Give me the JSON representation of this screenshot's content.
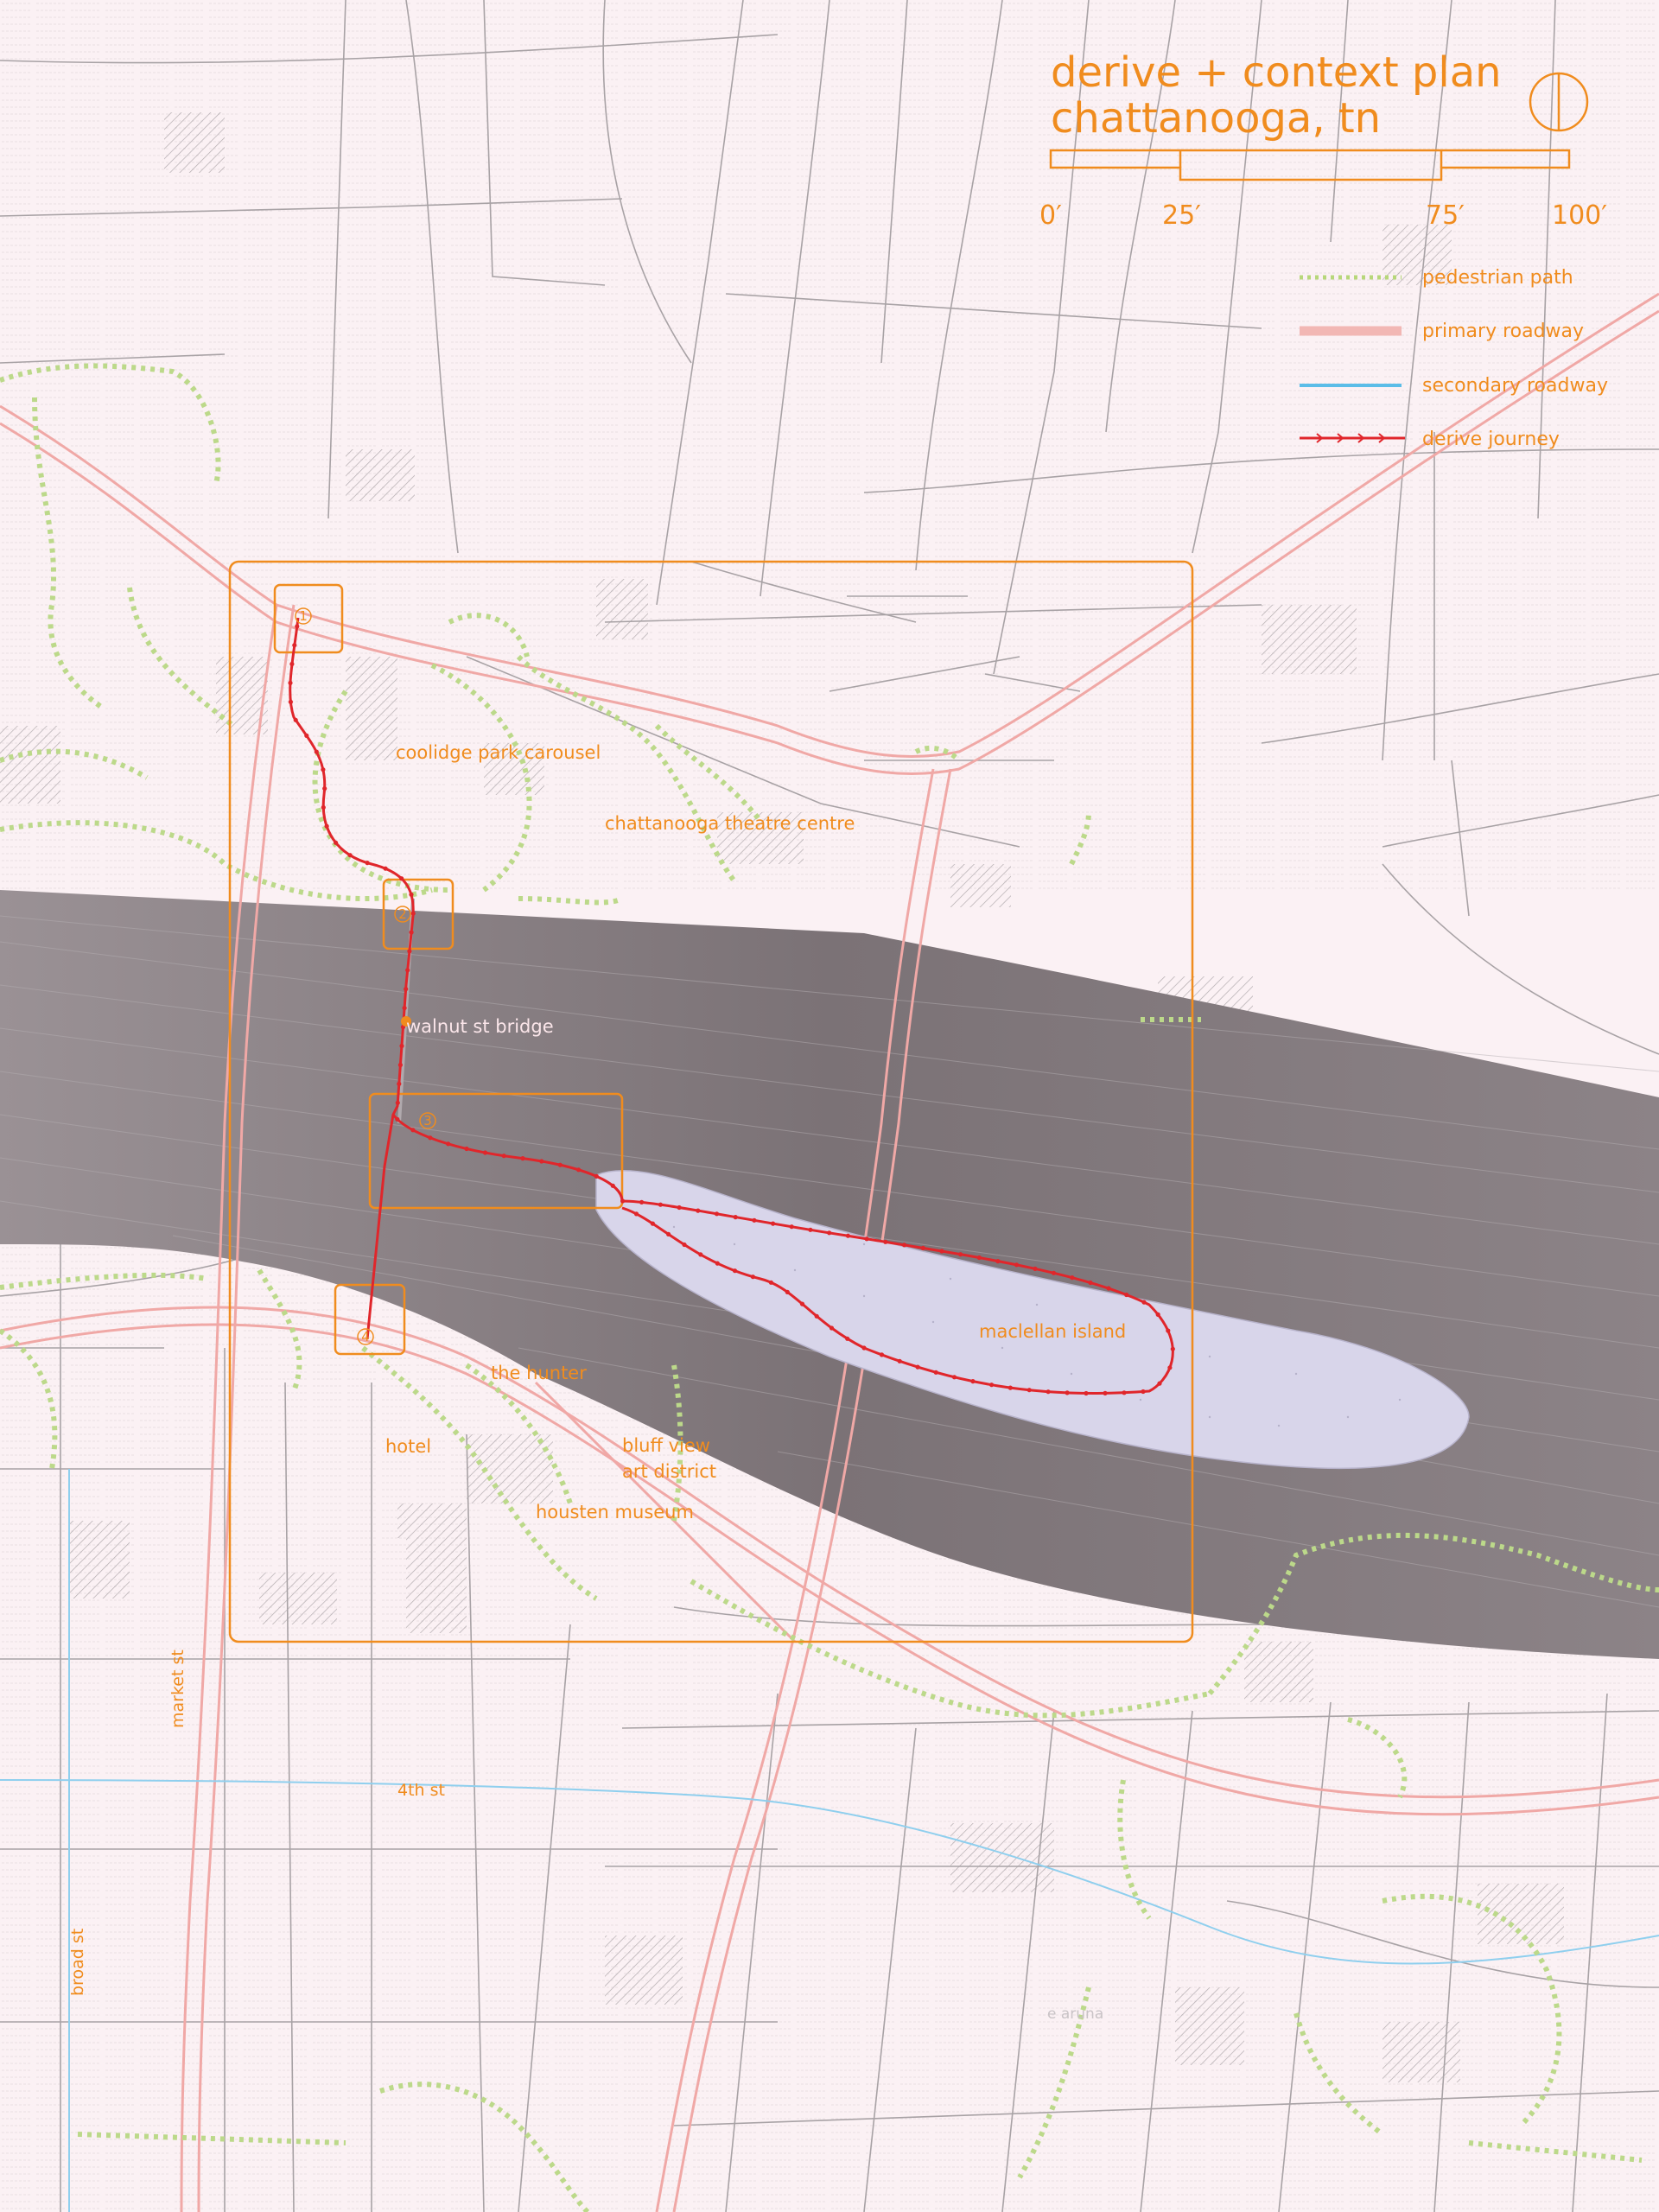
{
  "title": {
    "line1": "derive + context plan",
    "line2": "chattanooga, tn"
  },
  "scale": {
    "labels": [
      "0′",
      "25′",
      "75′",
      "100′"
    ]
  },
  "north_arrow_icon": "north-arrow-icon",
  "legend": {
    "items": [
      {
        "label": "pedestrian path",
        "icon": "pedestrian-path-icon",
        "color": "#b7d77a"
      },
      {
        "label": "primary roadway",
        "icon": "primary-roadway-icon",
        "color": "#f2b7b4"
      },
      {
        "label": "secondary roadway",
        "icon": "secondary-roadway-icon",
        "color": "#5bbde8"
      },
      {
        "label": "derive journey",
        "icon": "derive-journey-icon",
        "color": "#e0262b"
      }
    ]
  },
  "places": {
    "coolidge_park_carousel": "coolidge park carousel",
    "chattanooga_theatre_centre": "chattanooga theatre centre",
    "walnut_st_bridge": "walnut st bridge",
    "maclellan_island": "maclellan island",
    "the_hunter": "the hunter",
    "hotel": "hotel",
    "bluff_view_line1": "bluff view",
    "bluff_view_line2": "art district",
    "housten_museum": "housten museum"
  },
  "streets": {
    "fourth_st": "4th st",
    "market_st": "market st",
    "broad_st": "broad st",
    "e_aruna": "e aruna"
  },
  "stops": [
    "1",
    "2",
    "3",
    "4"
  ],
  "colors": {
    "accent_orange": "#f08c1e",
    "route_red": "#e0262b",
    "river": "#7d7478",
    "island": "#d9d6ec",
    "background": "#fbf1f4"
  }
}
